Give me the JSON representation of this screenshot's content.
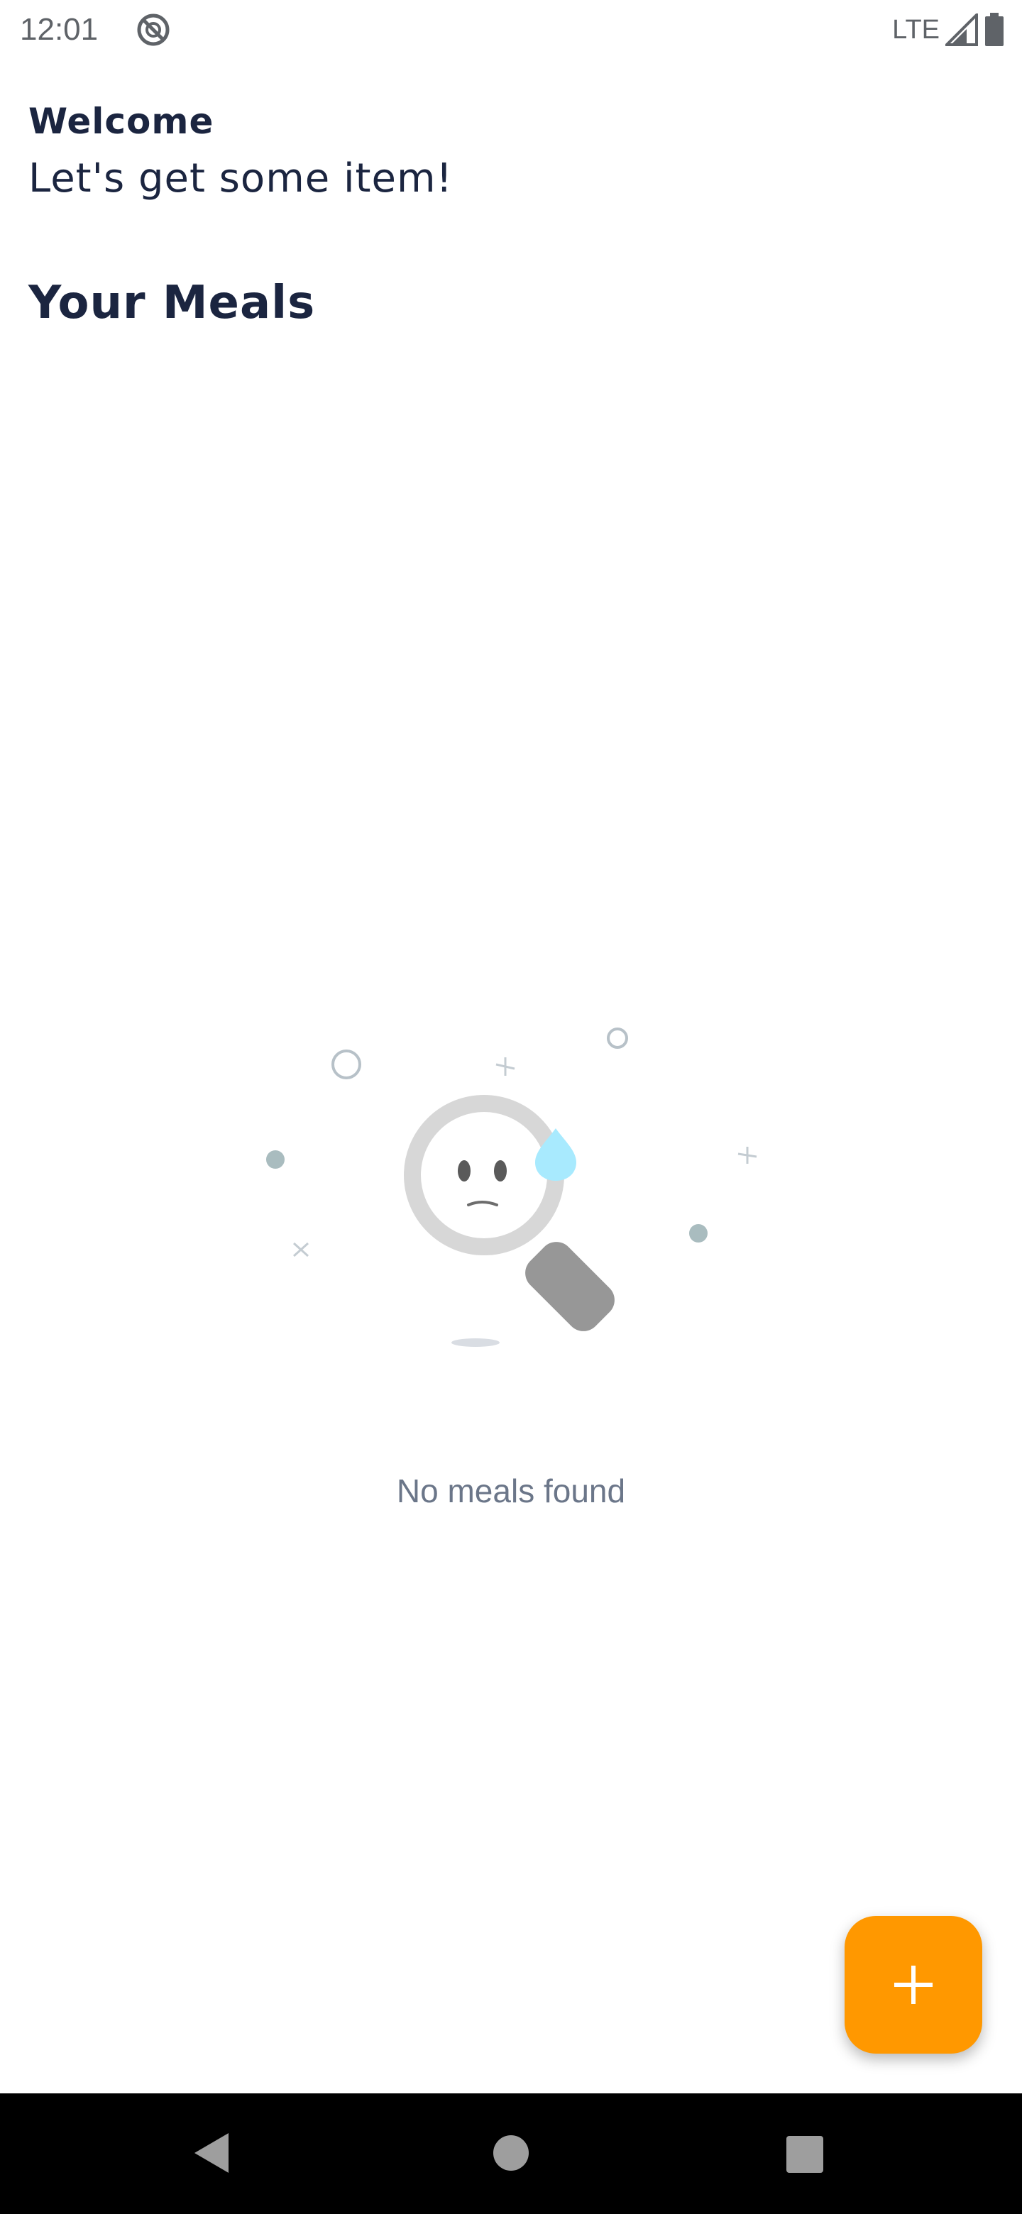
{
  "status_bar": {
    "time": "12:01",
    "network": "LTE",
    "icons": [
      "sync-blocked-icon",
      "signal-icon",
      "battery-icon"
    ]
  },
  "header": {
    "welcome": "Welcome",
    "subtitle": "Let's get some item!"
  },
  "section": {
    "title": "Your Meals"
  },
  "empty_state": {
    "illustration": "sad-magnifier-illustration",
    "message": "No meals found"
  },
  "fab": {
    "icon": "plus-icon",
    "color": "#ff9800"
  },
  "navigation": {
    "icons": [
      "back-icon",
      "home-icon",
      "recents-icon"
    ]
  },
  "colors": {
    "text_primary": "#1b2540",
    "text_muted": "#6b7689",
    "accent": "#ff9800"
  }
}
